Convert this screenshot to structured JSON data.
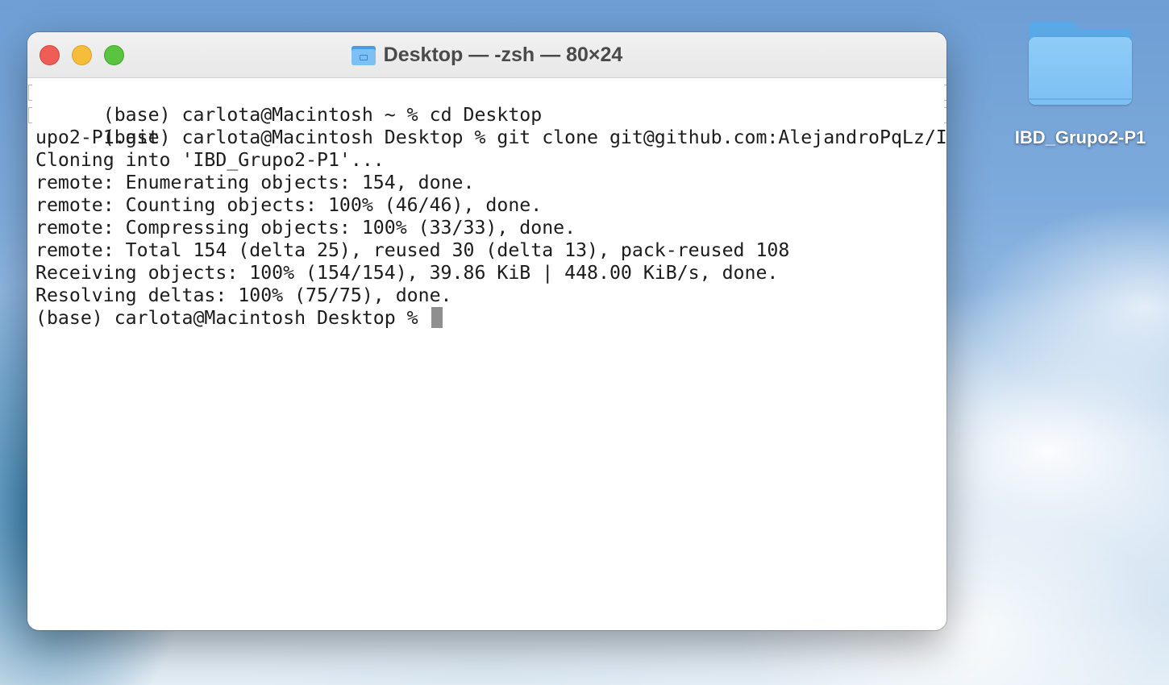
{
  "desktop": {
    "folder": {
      "icon": "folder-icon",
      "label": "IBD_Grupo2-P1"
    }
  },
  "window": {
    "title": "Desktop — -zsh — 80×24",
    "title_icon": "folder-icon",
    "controls": {
      "close": "close-button",
      "minimize": "minimize-button",
      "zoom": "zoom-button"
    },
    "colors": {
      "close": "#ee5d56",
      "minimize": "#f6bd3b",
      "zoom": "#5ac33f"
    }
  },
  "terminal": {
    "lines": [
      "(base) carlota@Macintosh ~ % cd Desktop",
      "(base) carlota@Macintosh Desktop % git clone git@github.com:AlejandroPqLz/IBD_Gr",
      "upo2-P1.git",
      "Cloning into 'IBD_Grupo2-P1'...",
      "remote: Enumerating objects: 154, done.",
      "remote: Counting objects: 100% (46/46), done.",
      "remote: Compressing objects: 100% (33/33), done.",
      "remote: Total 154 (delta 25), reused 30 (delta 13), pack-reused 108",
      "Receiving objects: 100% (154/154), 39.86 KiB | 448.00 KiB/s, done.",
      "Resolving deltas: 100% (75/75), done.",
      "(base) carlota@Macintosh Desktop % "
    ]
  }
}
